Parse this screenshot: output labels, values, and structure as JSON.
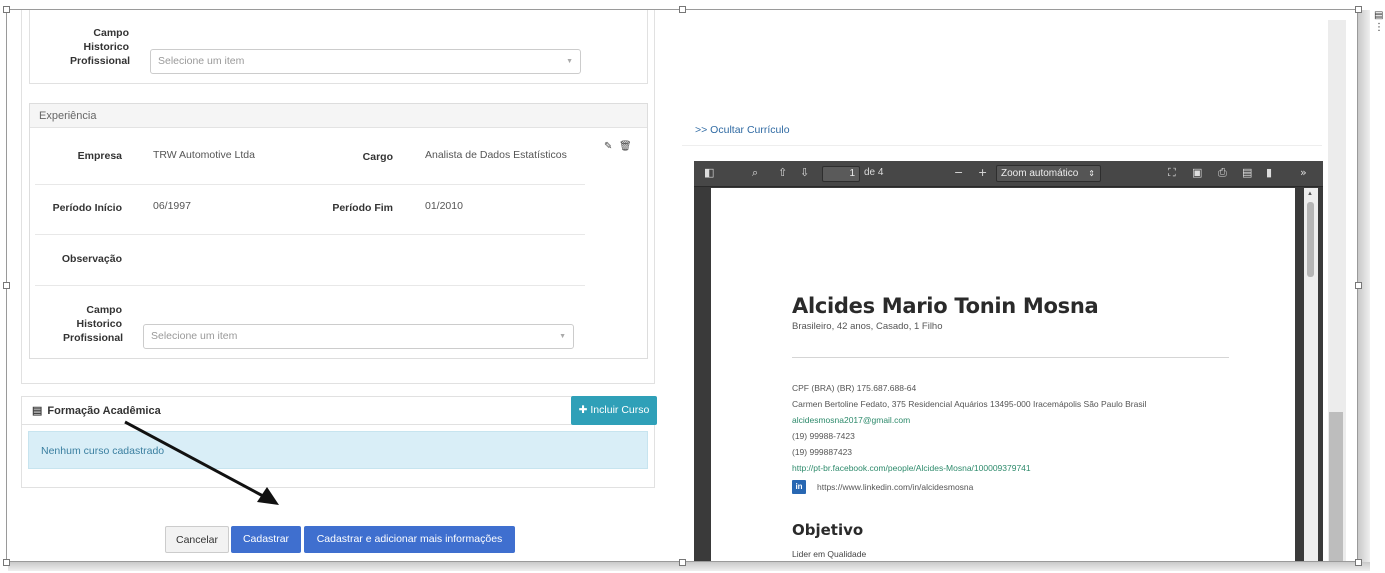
{
  "top_section": {
    "campo_label_lines": [
      "Campo",
      "Historico",
      "Profissional"
    ],
    "select_placeholder": "Selecione um item"
  },
  "experiencia": {
    "title": "Experiência",
    "labels": {
      "empresa": "Empresa",
      "cargo": "Cargo",
      "periodo_inicio": "Período Início",
      "periodo_fim": "Período Fim",
      "observacao": "Observação",
      "campo_lines": [
        "Campo",
        "Historico",
        "Profissional"
      ]
    },
    "values": {
      "empresa": "TRW Automotive Ltda",
      "cargo": "Analista de Dados Estatísticos",
      "periodo_inicio": "06/1997",
      "periodo_fim": "01/2010"
    },
    "select_placeholder": "Selecione um item",
    "icons": [
      "pencil-icon",
      "trash-icon"
    ]
  },
  "formacao": {
    "title": "Formação Acadêmica",
    "add_button": "Incluir Curso",
    "empty_message": "Nenhum curso cadastrado"
  },
  "actions": {
    "cancel": "Cancelar",
    "submit": "Cadastrar",
    "submit_more": "Cadastrar e adicionar mais informações"
  },
  "curriculo": {
    "toggle_link": ">> Ocultar Currículo",
    "viewer": {
      "page_current": "1",
      "page_total_label": "de 4",
      "zoom": "Zoom automático"
    },
    "cv": {
      "name": "Alcides Mario Tonin Mosna",
      "subtitle": "Brasileiro, 42 anos, Casado, 1 Filho",
      "cpf": "CPF (BRA) (BR) 175.687.688-64",
      "address": "Carmen Bertoline Fedato, 375 Residencial Aquários 13495-000 Iracemápolis São Paulo Brasil",
      "email": "alcidesmosna2017@gmail.com",
      "phone1": "(19) 99988-7423",
      "phone2": "(19) 999887423",
      "facebook": "http://pt-br.facebook.com/people/Alcides-Mosna/100009379741",
      "linkedin_badge": "in",
      "linkedin": "https://www.linkedin.com/in/alcidesmosna",
      "objective_title": "Objetivo",
      "objective_text": "Lider em Qualidade"
    }
  }
}
